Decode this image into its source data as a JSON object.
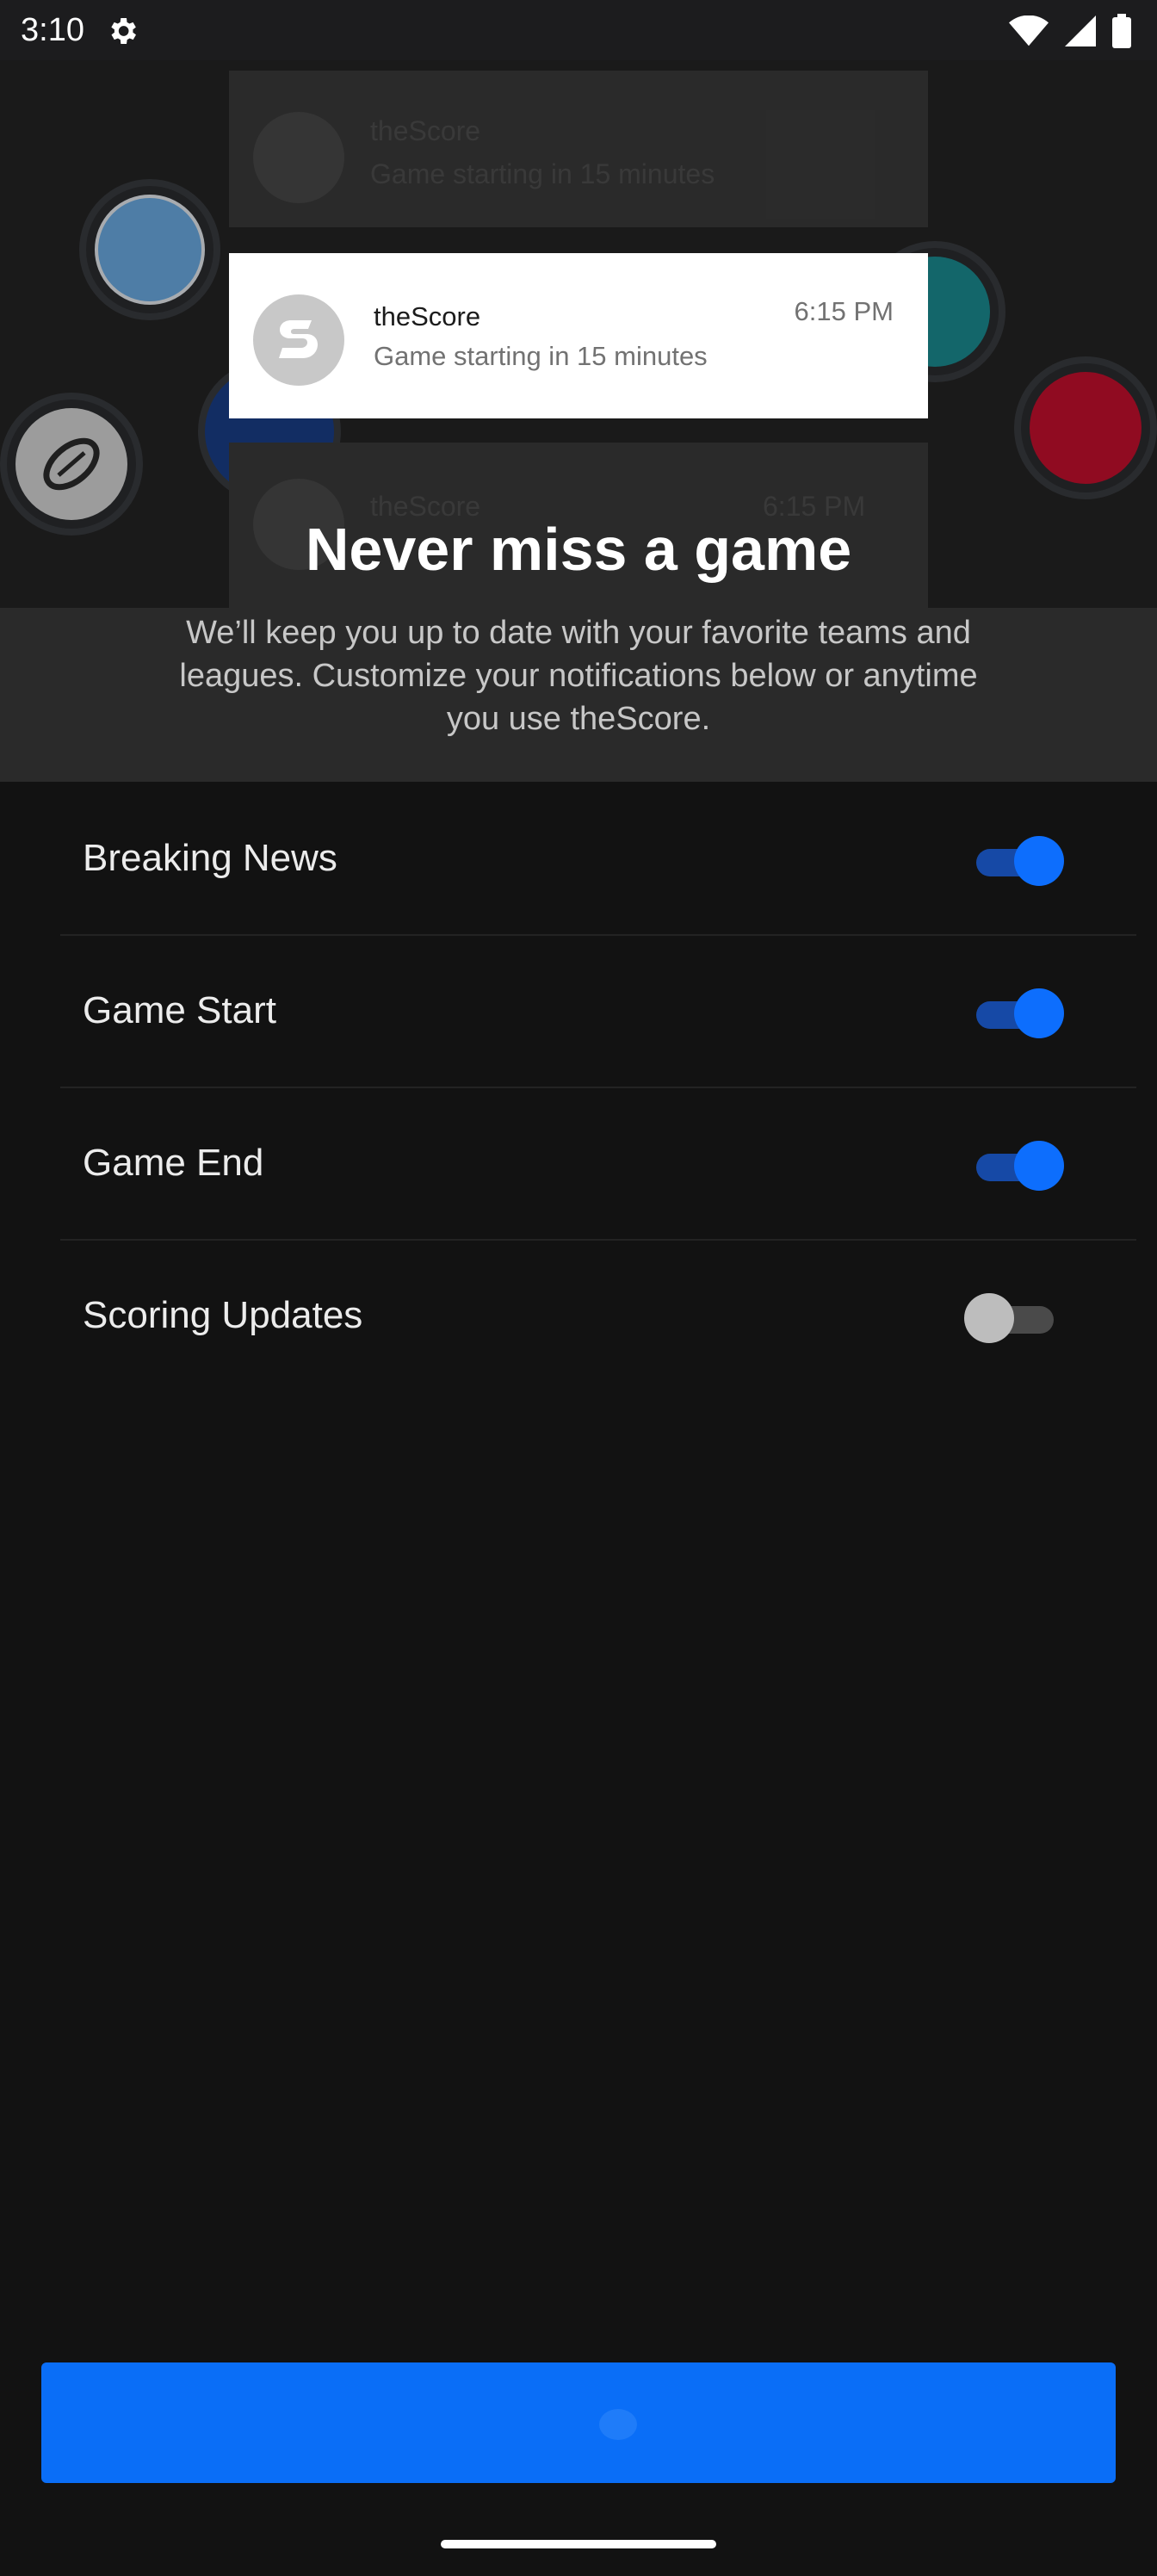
{
  "status_bar": {
    "time": "3:10",
    "icons": [
      "gear-icon",
      "wifi-icon",
      "signal-icon",
      "battery-icon"
    ]
  },
  "hero": {
    "team_logos": [
      "manchester-city-logo",
      "football-icon",
      "lightning-logo",
      "dolphins-logo",
      "raptors-logo"
    ],
    "notification": {
      "app_name": "theScore",
      "time": "6:15 PM",
      "body": "Game starting in 15 minutes"
    },
    "ghost_notifications": [
      {
        "app_name": "theScore",
        "body": "Game starting in 15 minutes"
      },
      {
        "app_name": "theScore",
        "body": "6:15 PM"
      }
    ],
    "title": "Never miss a game"
  },
  "intro": {
    "text": "We’ll keep you up to date with your favorite teams and leagues. Customize your notifications below or anytime you use theScore."
  },
  "settings": [
    {
      "label": "Breaking News",
      "enabled": true
    },
    {
      "label": "Game Start",
      "enabled": true
    },
    {
      "label": "Game End",
      "enabled": true
    },
    {
      "label": "Scoring Updates",
      "enabled": false
    }
  ],
  "colors": {
    "accent": "#0a6ef7",
    "background": "#121212",
    "toggle_off": "#bdbdbd"
  }
}
